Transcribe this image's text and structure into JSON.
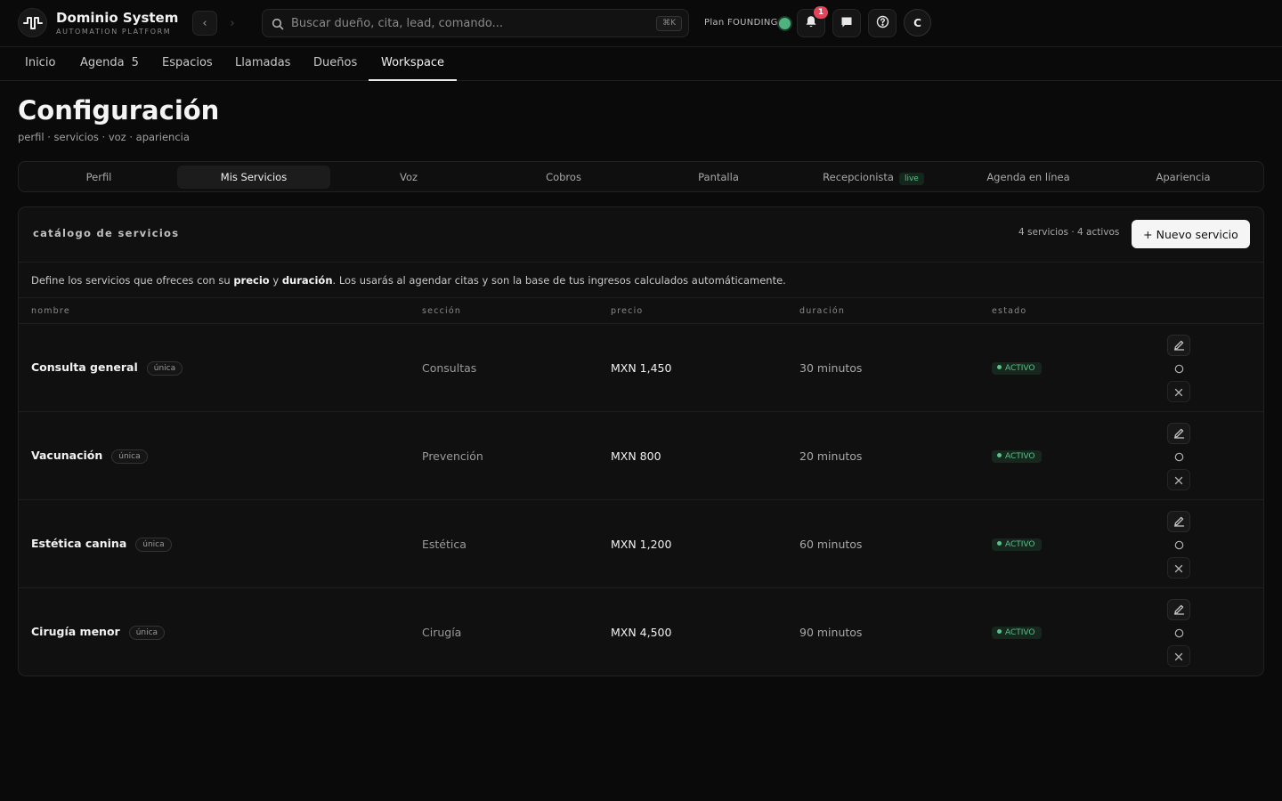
{
  "brand": {
    "name": "Dominio System",
    "subtitle": "AUTOMATION PLATFORM",
    "logo_icon": "signal-wave-icon"
  },
  "search": {
    "placeholder": "Buscar dueño, cita, lead, comando...",
    "shortcut": "⌘K"
  },
  "header": {
    "plan_label": "Plan FOUNDING",
    "plan_status_color": "#4fb37f",
    "notification_count": "1",
    "avatar_initial": "C"
  },
  "main_tabs": [
    {
      "label": "Inicio"
    },
    {
      "label": "Agenda",
      "count": "5"
    },
    {
      "label": "Espacios"
    },
    {
      "label": "Llamadas"
    },
    {
      "label": "Dueños"
    },
    {
      "label": "Workspace",
      "active": true
    }
  ],
  "page": {
    "title": "Configuración",
    "subtitle": "perfil · servicios · voz · apariencia"
  },
  "settings_tabs": [
    {
      "label": "Perfil"
    },
    {
      "label": "Mis Servicios",
      "active": true
    },
    {
      "label": "Voz"
    },
    {
      "label": "Cobros"
    },
    {
      "label": "Pantalla"
    },
    {
      "label": "Recepcionista",
      "tag": "live"
    },
    {
      "label": "Agenda en línea"
    },
    {
      "label": "Apariencia"
    }
  ],
  "catalog": {
    "title": "catálogo de servicios",
    "summary": "4 servicios · 4 activos",
    "new_button": "+ Nuevo servicio",
    "description": {
      "part1": "Define los servicios que ofreces con su ",
      "bold1": "precio",
      "part2": " y ",
      "bold2": "duración",
      "part3": ". Los usarás al agendar citas y son la base de tus ingresos calculados automáticamente."
    },
    "columns": [
      "nombre",
      "sección",
      "precio",
      "duración",
      "estado"
    ],
    "rows": [
      {
        "name": "Consulta general",
        "tag": "única",
        "section": "Consultas",
        "price": "MXN 1,450",
        "duration": "30 minutos",
        "status": "ACTIVO"
      },
      {
        "name": "Vacunación",
        "tag": "única",
        "section": "Prevención",
        "price": "MXN 800",
        "duration": "20 minutos",
        "status": "ACTIVO"
      },
      {
        "name": "Estética canina",
        "tag": "única",
        "section": "Estética",
        "price": "MXN 1,200",
        "duration": "60 minutos",
        "status": "ACTIVO"
      },
      {
        "name": "Cirugía menor",
        "tag": "única",
        "section": "Cirugía",
        "price": "MXN 4,500",
        "duration": "90 minutos",
        "status": "ACTIVO"
      }
    ]
  },
  "colors": {
    "background": "#0a0a0a",
    "accent_green": "#5cc08a",
    "notification_red": "#e0455a"
  }
}
